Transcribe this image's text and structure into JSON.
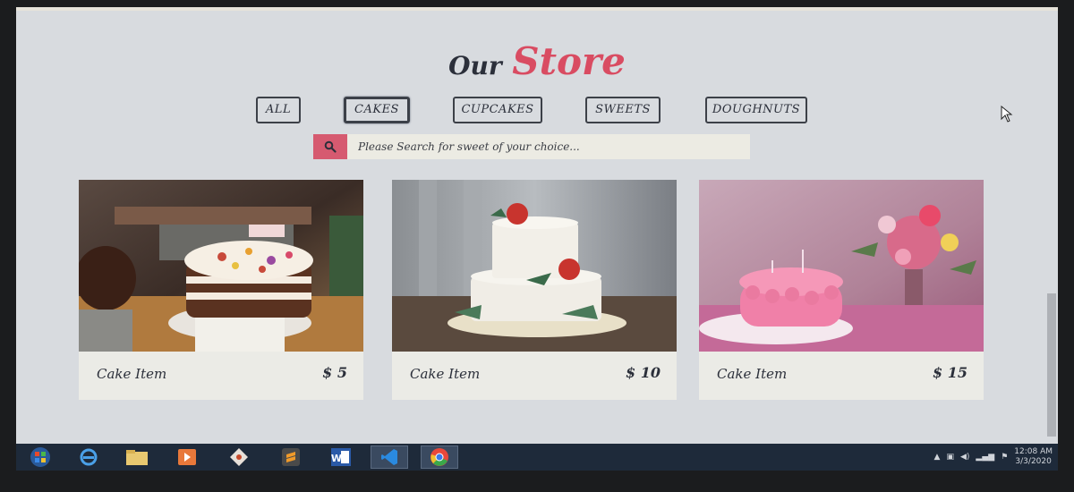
{
  "header": {
    "title_part1": "Our",
    "title_part2": "Store"
  },
  "filters": [
    "ALL",
    "CAKES",
    "CUPCAKES",
    "SWEETS",
    "DOUGHNUTS"
  ],
  "active_filter": "CAKES",
  "search": {
    "placeholder": "Please Search for sweet of your choice...",
    "icon": "search-icon"
  },
  "products": [
    {
      "name": "Cake Item",
      "price": "$ 5"
    },
    {
      "name": "Cake Item",
      "price": "$ 10"
    },
    {
      "name": "Cake Item",
      "price": "$ 15"
    }
  ],
  "taskbar": {
    "apps": [
      "start-icon",
      "internet-explorer-icon",
      "file-explorer-icon",
      "media-player-icon",
      "git-icon",
      "sublime-text-icon",
      "word-icon",
      "vscode-icon",
      "chrome-icon"
    ],
    "word_label": "W",
    "clock_time": "12:08 AM",
    "clock_date": "3/3/2020"
  },
  "colors": {
    "accent": "#d94c62",
    "text": "#2b2f3a",
    "background": "#d8dbdf",
    "card": "#ebebe6"
  }
}
